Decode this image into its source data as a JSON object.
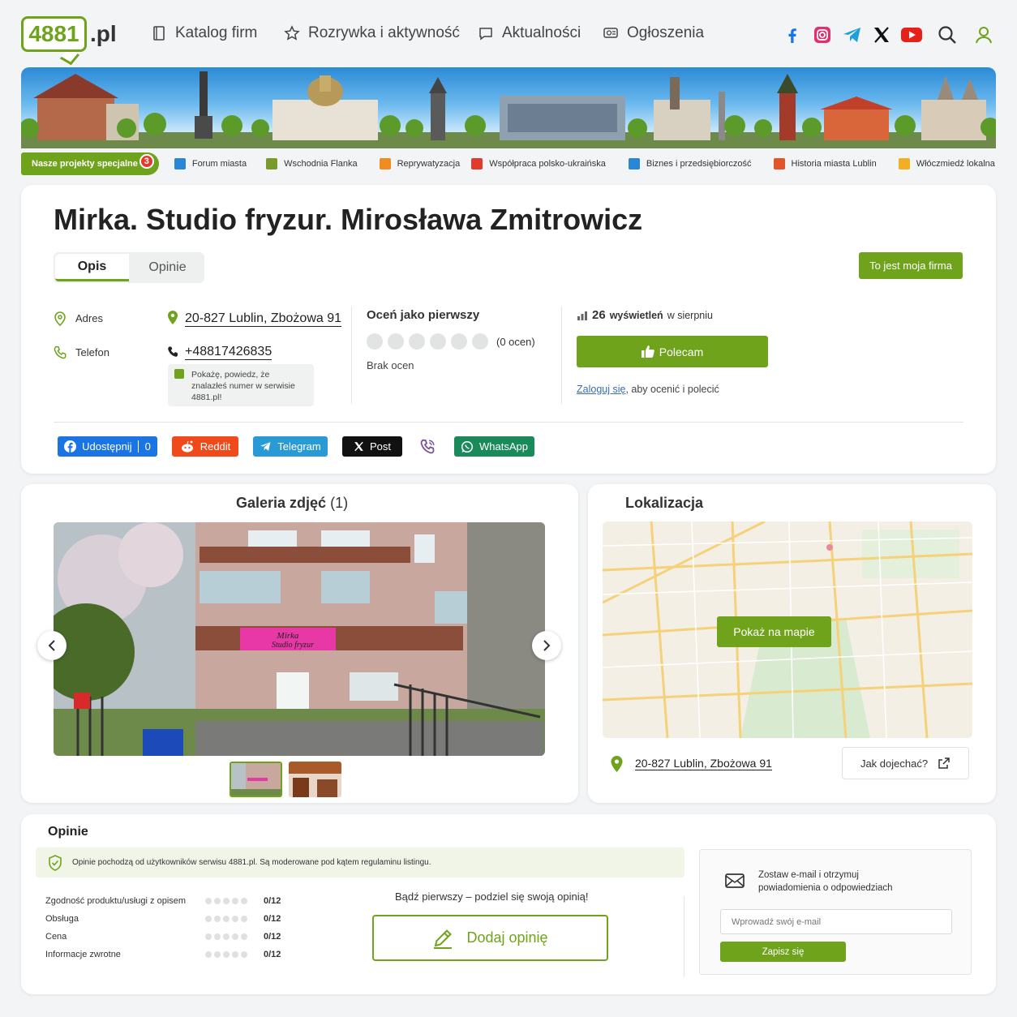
{
  "header": {
    "logo": "4881",
    "logo_suffix": ".pl",
    "nav": [
      {
        "label": "Katalog firm",
        "icon": "book-icon"
      },
      {
        "label": "Rozrywka i aktywność",
        "icon": "star-icon"
      },
      {
        "label": "Aktualności",
        "icon": "chat-icon"
      },
      {
        "label": "Ogłoszenia",
        "icon": "megaphone-icon"
      }
    ],
    "social": [
      "facebook-icon",
      "instagram-icon",
      "telegram-icon",
      "x-icon",
      "youtube-icon"
    ],
    "colors": {
      "brand": "#6fa31c"
    }
  },
  "projects": {
    "badge": "Nasze projekty specjalne",
    "count": "3",
    "items": [
      {
        "label": "Forum miasta",
        "color": "#2a87d6"
      },
      {
        "label": "Wschodnia Flanka",
        "color": "#7a9a2a"
      },
      {
        "label": "Reprywatyzacja",
        "color": "#f08c22"
      },
      {
        "label": "Współpraca polsko-ukraińska",
        "color": "#e23b2e"
      },
      {
        "label": "Biznes i przedsiębiorczość",
        "color": "#2a87d6"
      },
      {
        "label": "Historia miasta Lublin",
        "color": "#e2542a"
      },
      {
        "label": "Włóczmiedź lokalna",
        "color": "#f0b022"
      }
    ]
  },
  "company": {
    "title": "Mirka. Studio fryzur. Mirosława Zmitrowicz",
    "tabs": [
      "Opis",
      "Opinie"
    ],
    "claim_button": "To jest moja firma",
    "address_label": "Adres",
    "address": "20-827 Lublin, Zbożowa 91",
    "phone_label": "Telefon",
    "phone": "+48817426835",
    "phone_note": "Pokażę, powiedz, że znalazłeś numer w serwisie 4881.pl!",
    "rate_title": "Oceń jako pierwszy",
    "rate_count": "(0 ocen)",
    "rate_none": "Brak ocen",
    "views_count": "26",
    "views_word": "wyświetleń",
    "views_suffix": "w sierpniu",
    "recommend_button": "Polecam",
    "login_link": "Zaloguj się",
    "login_suffix": ", aby ocenić i polecić"
  },
  "share": {
    "facebook": "Udostępnij",
    "facebook_count": "0",
    "reddit": "Reddit",
    "telegram": "Telegram",
    "x": "Post",
    "whatsapp": "WhatsApp"
  },
  "gallery": {
    "title": "Galeria zdjęć",
    "count": "(1)",
    "sign_line1": "Mirka",
    "sign_line2": "Studio fryzur"
  },
  "location": {
    "title": "Lokalizacja",
    "map_button": "Pokaż na mapie",
    "address": "20-827 Lublin, Zbożowa 91",
    "directions": "Jak dojechać?"
  },
  "opinions": {
    "title": "Opinie",
    "notice": "Opinie pochodzą od użytkowników serwisu 4881.pl. Są moderowane pod kątem regulaminu listingu.",
    "criteria": [
      {
        "label": "Zgodność produktu/usługi z opisem",
        "score": "0/12"
      },
      {
        "label": "Obsługa",
        "score": "0/12"
      },
      {
        "label": "Cena",
        "score": "0/12"
      },
      {
        "label": "Informacje zwrotne",
        "score": "0/12"
      }
    ],
    "first_text": "Bądź pierwszy – podziel się swoją opinią!",
    "add_button": "Dodaj opinię",
    "subscribe_text": "Zostaw e-mail i otrzymuj powiadomienia o odpowiedziach",
    "email_placeholder": "Wprowadź swój e-mail",
    "subscribe_button": "Zapisz się"
  }
}
